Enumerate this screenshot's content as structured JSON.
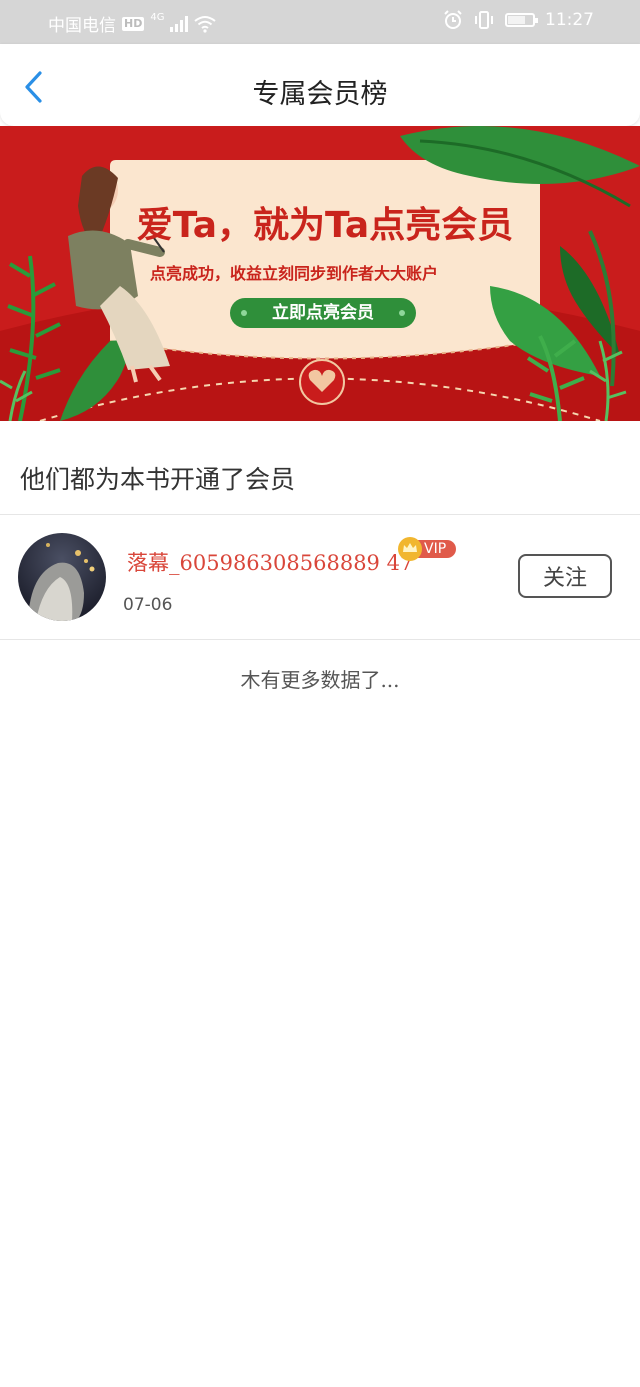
{
  "status_bar": {
    "carrier": "中国电信",
    "hd": "HD",
    "network": "4G",
    "time": "11:27",
    "battery": "71"
  },
  "nav": {
    "title": "专属会员榜",
    "back_icon": "chevron-left-icon"
  },
  "banner": {
    "headline": "爱Ta，就为Ta点亮会员",
    "subline": "点亮成功，收益立刻同步到作者大大账户",
    "button_label": "立即点亮会员",
    "colors": {
      "red": "#c91c1c",
      "cream": "#fbe6cf",
      "green": "#2f8f3a"
    }
  },
  "section_title": "他们都为本书开通了会员",
  "members": [
    {
      "name": "落幕_605986308568889 47",
      "badge": "VIP",
      "date": "07-06",
      "follow_label": "关注"
    }
  ],
  "footer_text": "木有更多数据了..."
}
